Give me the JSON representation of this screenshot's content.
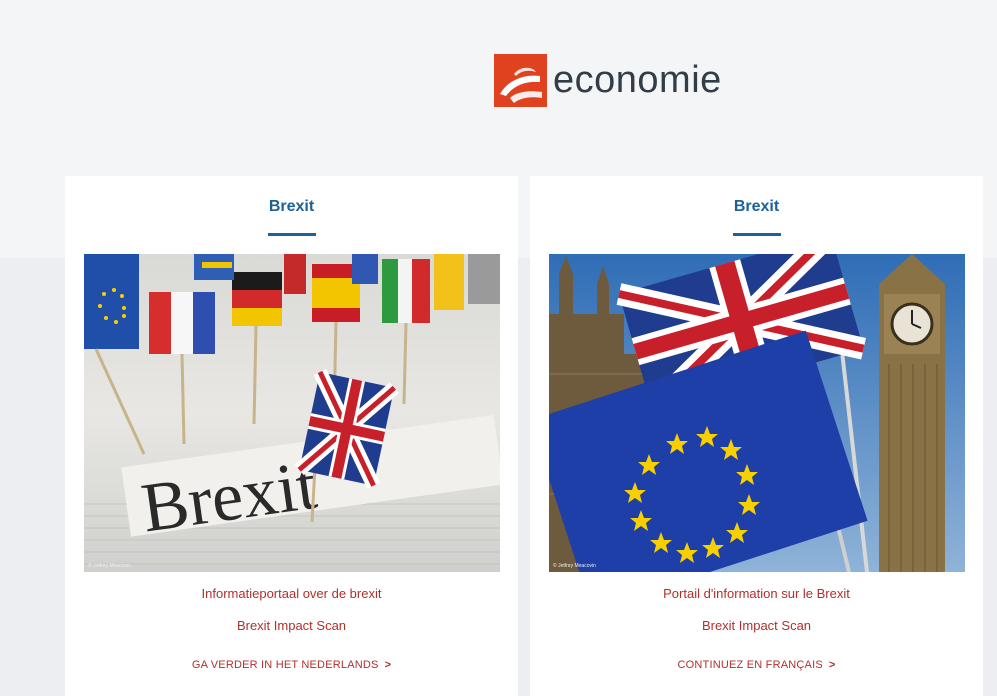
{
  "logo": {
    "text": "economie"
  },
  "cards": [
    {
      "title": "Brexit",
      "image": "brexit-newspaper-flags",
      "image_credit": "© Jetfrey Meacovin",
      "link_portal": "Informatieportaal over de brexit",
      "link_scan": "Brexit Impact Scan",
      "link_continue": "GA VERDER IN HET NEDERLANDS"
    },
    {
      "title": "Brexit",
      "image": "uk-eu-flags-big-ben",
      "image_credit": "© Jetfrey Meacovin",
      "link_portal": "Portail d'information sur le Brexit",
      "link_scan": "Brexit Impact Scan",
      "link_continue": "CONTINUEZ EN FRANÇAIS"
    }
  ],
  "colors": {
    "brand_orange": "#e0411f",
    "title_blue": "#1d6199",
    "link_red": "#b0302a",
    "page_bg": "#f4f5f7"
  },
  "icons": {
    "chevron": "chevron-right-icon"
  }
}
